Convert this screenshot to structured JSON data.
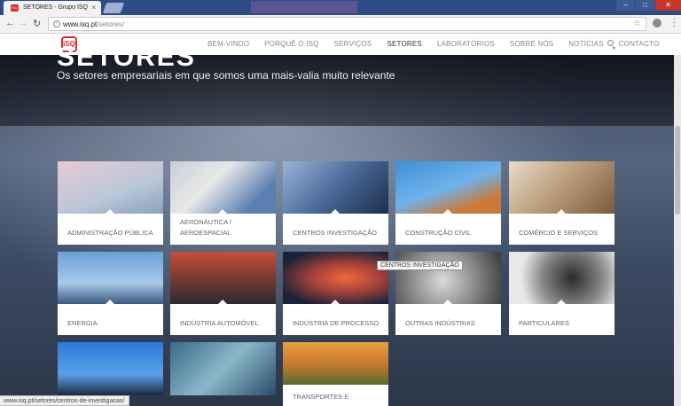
{
  "browser": {
    "tab_title": "SETORES - Grupo ISQ",
    "tab_close": "×",
    "url_host": "www.isq.pt",
    "url_path": "/setores/",
    "window_controls": [
      "–",
      "□",
      "✕"
    ]
  },
  "site": {
    "logo_text": "iSQ",
    "nav": [
      {
        "label": "BEM-VINDO",
        "active": false
      },
      {
        "label": "PORQUÊ O ISQ",
        "active": false
      },
      {
        "label": "SERVIÇOS",
        "active": false
      },
      {
        "label": "SETORES",
        "active": true
      },
      {
        "label": "LABORATÓRIOS",
        "active": false
      },
      {
        "label": "SOBRE NÓS",
        "active": false
      },
      {
        "label": "NOTÍCIAS",
        "active": false
      },
      {
        "label": "CONTACTO",
        "active": false
      }
    ]
  },
  "hero": {
    "title": "SETORES",
    "subtitle": "Os setores empresariais em que somos uma mais-valia muito relevante"
  },
  "sectors": [
    {
      "label": "ADMINISTRAÇÃO PÚBLICA"
    },
    {
      "label": "AERONÁUTICA / AEROESPACIAL"
    },
    {
      "label": "CENTROS INVESTIGAÇÃO"
    },
    {
      "label": "CONSTRUÇÃO CIVIL"
    },
    {
      "label": "COMÉRCIO E SERVIÇOS"
    },
    {
      "label": "ENERGIA"
    },
    {
      "label": "INDÚSTRIA AUTOMÓVEL"
    },
    {
      "label": "INDÚSTRIA DE PROCESSO"
    },
    {
      "label": "OUTRAS INDÚSTRIAS"
    },
    {
      "label": "PARTICULARES"
    },
    {
      "label": ""
    },
    {
      "label": ""
    },
    {
      "label": "TRANSPORTES E"
    }
  ],
  "tooltip": "CENTROS INVESTIGAÇÃO",
  "status_url": "www.isq.pt/setores/centros-de-investigacao/"
}
